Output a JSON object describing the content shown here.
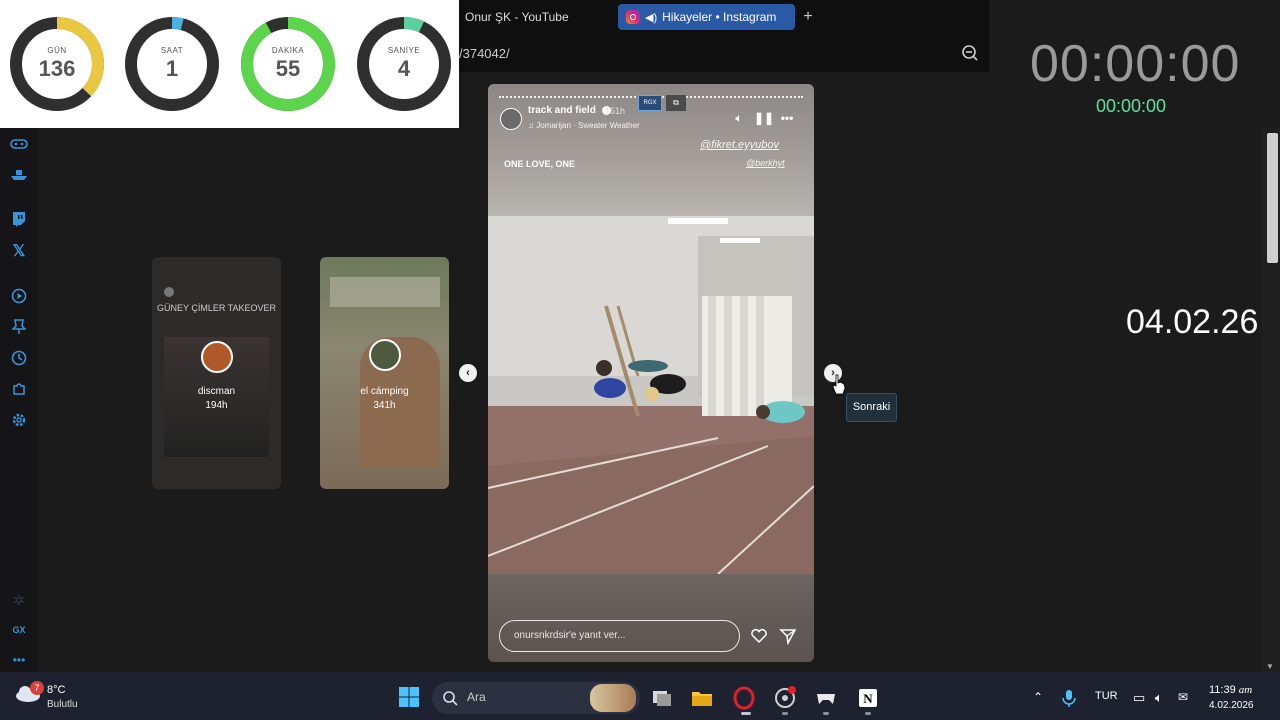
{
  "countdown": {
    "days": {
      "label": "GÜN",
      "value": "136",
      "fraction": 0.37,
      "color": "#e8c840"
    },
    "hours": {
      "label": "SAAT",
      "value": "1",
      "fraction": 0.04,
      "color": "#4fb0e0"
    },
    "minutes": {
      "label": "DAKİKA",
      "value": "55",
      "fraction": 0.92,
      "color": "#5cd44c"
    },
    "seconds": {
      "label": "SANİYE",
      "value": "4",
      "fraction": 0.07,
      "color": "#5ccfa0"
    }
  },
  "browser": {
    "tabs": [
      {
        "label": "Onur ŞK - YouTube"
      },
      {
        "label": "Hikayeler • Instagram"
      }
    ],
    "url_fragment": "/374042/"
  },
  "clocks": {
    "big": "00:00:00",
    "small": "00:00:00",
    "date": "04.02.26"
  },
  "side_stories": [
    {
      "title": "GÜNEY ÇİMLER TAKEOVER",
      "name": "discman",
      "time": "194h"
    },
    {
      "name": "el cámping",
      "time": "341h"
    }
  ],
  "story": {
    "user": "track and field",
    "time": "151h",
    "song": "Jomarijan · Sweater Weather",
    "mention1": "@fikret.eyyubov",
    "mention2": "@berkhyt",
    "caption": "ONE LOVE, ONE",
    "reply_placeholder": "onursnkrdsir'e yanıt ver...",
    "rgx_label": "RGX"
  },
  "tooltip": "Sonraki",
  "taskbar": {
    "temp": "8°C",
    "weather": "Bulutlu",
    "weather_badge": "7",
    "search": "Ara",
    "lang": "TUR",
    "time": "11:39",
    "ampm": "am",
    "date": "4.02.2026"
  },
  "sidebar_icons": [
    "gamepad-icon",
    "ship-icon",
    "twitch-icon",
    "x-icon",
    "player-icon",
    "pin-icon",
    "history-icon",
    "extensions-icon",
    "settings-icon",
    "wallet-icon",
    "gx-icon",
    "more-icon"
  ]
}
